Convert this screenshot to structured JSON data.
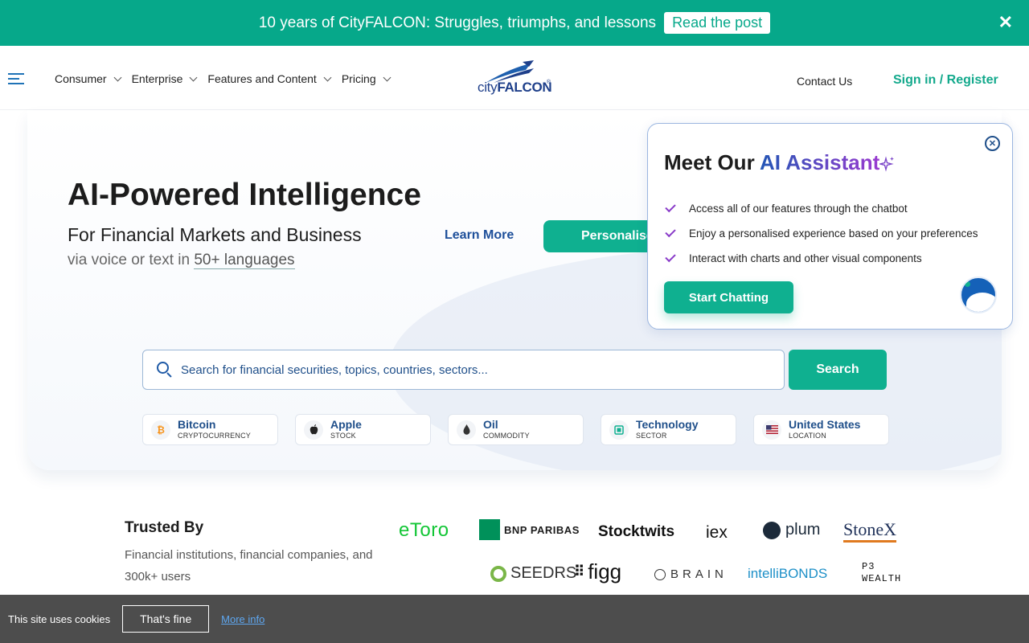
{
  "announcement": {
    "text": "10 years of CityFALCON: Struggles, triumphs, and lessons",
    "button": "Read the post",
    "close": "✕"
  },
  "header": {
    "logo_city": "city",
    "logo_falcon": "FALCON",
    "logo_reg": "®",
    "nav": [
      {
        "label": "Consumer"
      },
      {
        "label": "Enterprise"
      },
      {
        "label": "Features and Content"
      },
      {
        "label": "Pricing"
      }
    ],
    "contact": "Contact Us",
    "signin": "Sign in / Register"
  },
  "hero": {
    "title": "AI-Powered Intelligence",
    "subtitle": "For Financial Markets and Business",
    "subtitle2_prefix": "via voice or text in ",
    "subtitle2_link": "50+ languages",
    "learn_more": "Learn More",
    "personalise": "Personalise",
    "search_placeholder": "Search for financial securities, topics, countries, sectors...",
    "search_button": "Search",
    "chips": [
      {
        "name": "Bitcoin",
        "type": "CRYPTOCURRENCY",
        "icon": "bitcoin-icon",
        "glyph": "₿",
        "color": "#f7931a"
      },
      {
        "name": "Apple",
        "type": "STOCK",
        "icon": "apple-icon",
        "glyph": "",
        "color": "#222222"
      },
      {
        "name": "Oil",
        "type": "COMMODITY",
        "icon": "oil-drop-icon",
        "glyph": "💧",
        "color": "#333333"
      },
      {
        "name": "Technology",
        "type": "SECTOR",
        "icon": "chip-icon",
        "glyph": "▣",
        "color": "#0fb090"
      },
      {
        "name": "United States",
        "type": "LOCATION",
        "icon": "us-flag-icon",
        "glyph": "🇺🇸",
        "color": "#b22234"
      }
    ]
  },
  "assistant": {
    "title_prefix": "Meet Our ",
    "title_highlight": "AI Assistant",
    "features": [
      "Access all of our features through the chatbot",
      "Enjoy a personalised experience based on your preferences",
      "Interact with charts and other visual components"
    ],
    "cta": "Start Chatting"
  },
  "trusted": {
    "title": "Trusted By",
    "description": "Financial institutions, financial companies, and 300k+ users",
    "logos": [
      "eToro",
      "BNP PARIBAS",
      "Stocktwits",
      "iex",
      "plum",
      "StoneX",
      "SEEDRS",
      "figg",
      "BRAIN",
      "intelliBONDS",
      "P3 WEALTH"
    ]
  },
  "cookie": {
    "text": "This site uses cookies",
    "button": "That's fine",
    "more": "More info"
  },
  "colors": {
    "brand_green": "#06a88a",
    "brand_blue": "#1e3f8a",
    "accent_purple": "#8a3cc9"
  }
}
